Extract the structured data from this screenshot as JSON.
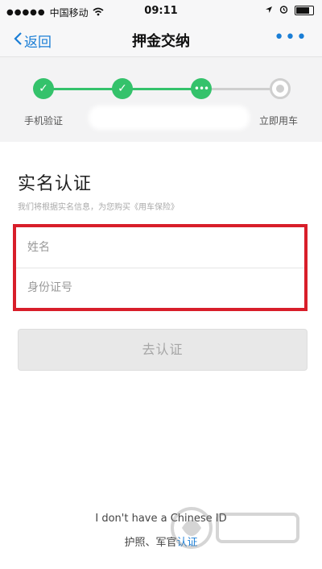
{
  "status": {
    "carrier": "中国移动",
    "time": "09:11"
  },
  "nav": {
    "back_label": "返回",
    "title": "押金交纳",
    "more_label": "•••"
  },
  "progress": {
    "steps": [
      {
        "label": "手机验证",
        "state": "done"
      },
      {
        "label": "",
        "state": "done"
      },
      {
        "label": "",
        "state": "current"
      },
      {
        "label": "立即用车",
        "state": "pending"
      }
    ]
  },
  "form": {
    "title": "实名认证",
    "subtitle": "我们将根据实名信息，为您购买《用车保险》",
    "name_placeholder": "姓名",
    "id_placeholder": "身份证号",
    "submit_label": "去认证"
  },
  "footer": {
    "line1": "I don't have a Chinese ID",
    "line2_prefix": "护照、军官",
    "line2_link": "认证"
  },
  "colors": {
    "accent": "#1a7ed6",
    "success": "#34c26b",
    "highlight": "#d81e2a"
  }
}
